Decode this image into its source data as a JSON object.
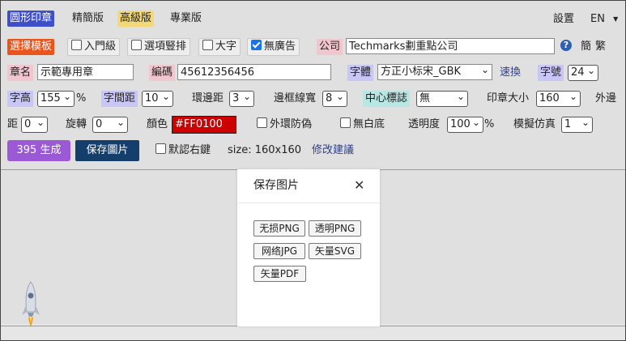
{
  "nav": {
    "tab_seal": "圆形印章",
    "tab_simple": "精簡版",
    "tab_advanced": "高級版",
    "tab_pro": "專業版",
    "settings": "設置",
    "lang": "EN",
    "lang_arrow": "▼"
  },
  "row2": {
    "select_template": "選擇模板",
    "beginner": "入門級",
    "vertical_options": "選項豎排",
    "large_text": "大字",
    "no_ads": "無廣告",
    "company_label": "公司",
    "company_value": "Techmarks劃重點公司",
    "help_icon": "?",
    "simplified": "簡",
    "traditional": "繁"
  },
  "row3": {
    "seal_name_label": "章名",
    "seal_name_value": "示範專用章",
    "code_label": "編碼",
    "code_value": "45612356456",
    "font_label": "字體",
    "font_value": "方正小标宋_GBK",
    "quick_change": "速換",
    "font_size_label": "字號",
    "font_size_value": "24"
  },
  "row4": {
    "char_height_label": "字高",
    "char_height_value": "155",
    "percent": "%",
    "char_spacing_label": "字間距",
    "char_spacing_value": "10",
    "ring_spacing_label": "環邊距",
    "ring_spacing_value": "3",
    "border_width_label": "邊框線寬",
    "border_width_value": "8",
    "center_mark_label": "中心標誌",
    "center_mark_value": "無",
    "seal_size_label": "印章大小",
    "seal_size_value": "160",
    "outer_label": "外邊"
  },
  "row5": {
    "outer_dist_label": "距",
    "outer_dist_value": "0",
    "rotate_label": "旋轉",
    "rotate_value": "0",
    "color_label": "顏色",
    "color_value": "#FF0100",
    "outer_ring_antifake": "外環防偽",
    "no_white_bg": "無白底",
    "opacity_label": "透明度",
    "opacity_value": "100",
    "percent": "%",
    "simulate_label": "模擬仿真",
    "simulate_value": "1"
  },
  "row6": {
    "generate": "395 生成",
    "save_image": "保存圖片",
    "default_right_click": "默認右鍵",
    "size_text": "size: 160x160",
    "suggestion": "修改建議"
  },
  "modal": {
    "title": "保存图片",
    "close": "✕",
    "buttons": [
      "无损PNG",
      "透明PNG",
      "网络JPG",
      "矢量SVG",
      "矢量PDF"
    ]
  },
  "colors": {
    "accent_blue": "#3f4fc7",
    "seal_red": "#FF0100",
    "generate_purple": "#9b59d6",
    "save_navy": "#143e6b"
  }
}
